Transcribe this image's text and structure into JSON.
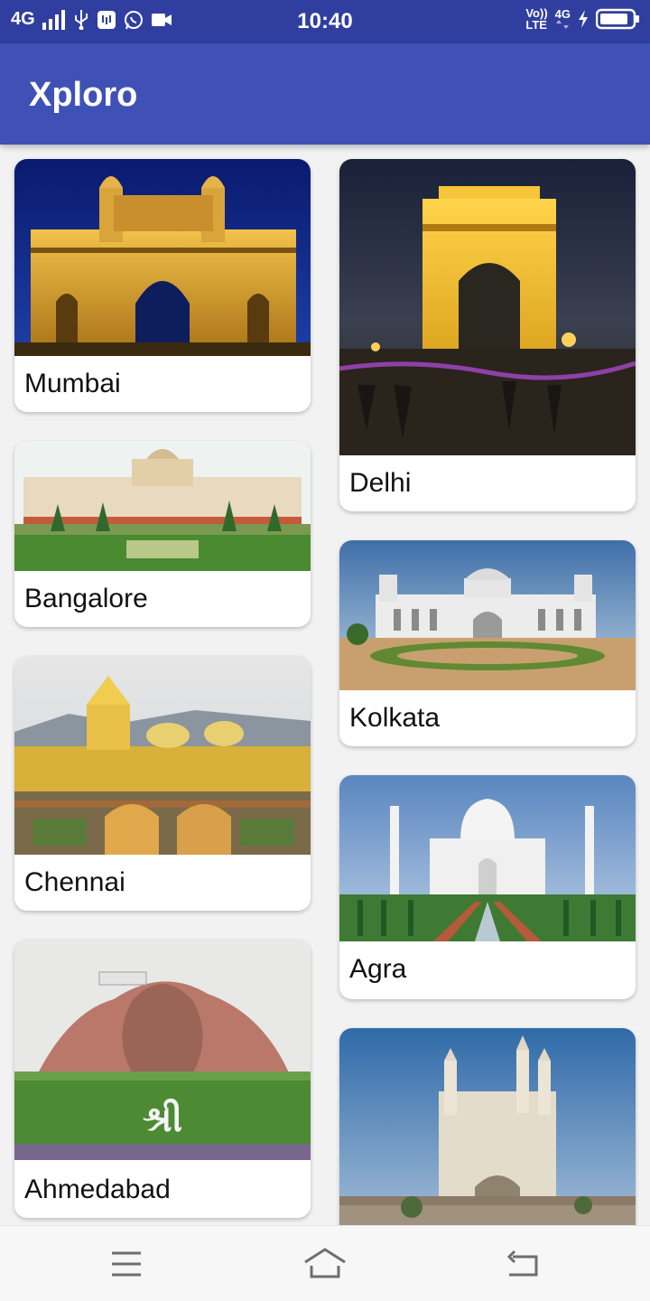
{
  "status_bar": {
    "network": "4G",
    "time": "10:40",
    "volte_top": "Vo))",
    "volte_bottom": "LTE",
    "network_right": "4G"
  },
  "app": {
    "title": "Xploro"
  },
  "cities": [
    {
      "name": "Mumbai",
      "landmark": "gateway-of-india"
    },
    {
      "name": "Delhi",
      "landmark": "india-gate"
    },
    {
      "name": "Bangalore",
      "landmark": "vidhana-soudha"
    },
    {
      "name": "Kolkata",
      "landmark": "victoria-memorial"
    },
    {
      "name": "Chennai",
      "landmark": "golden-temple"
    },
    {
      "name": "Agra",
      "landmark": "taj-mahal"
    },
    {
      "name": "Ahmedabad",
      "landmark": "ganesha-sculpture"
    },
    {
      "name": "",
      "landmark": "charminar"
    }
  ],
  "ahmedabad_garden_text": "શ્રી",
  "nav": {
    "icons": [
      "menu-icon",
      "home-icon",
      "back-icon"
    ]
  }
}
